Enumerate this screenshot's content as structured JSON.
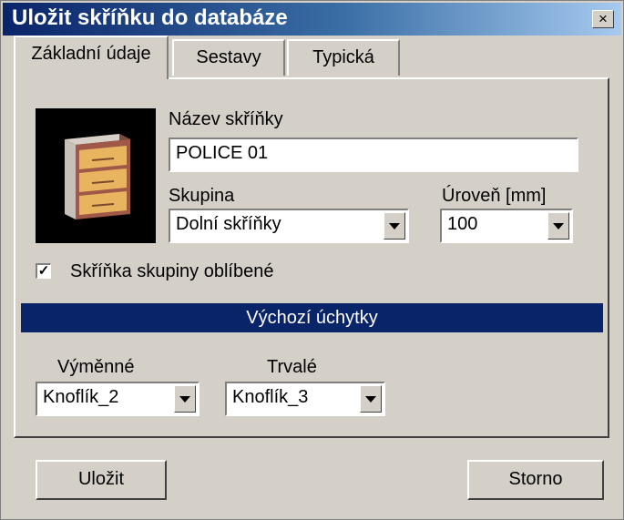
{
  "window": {
    "title": "Uložit skříňku do databáze",
    "close_label": "×"
  },
  "tabs": [
    {
      "label": "Základní údaje",
      "active": true
    },
    {
      "label": "Sestavy",
      "active": false
    },
    {
      "label": "Typická",
      "active": false
    }
  ],
  "form": {
    "name_label": "Název skříňky",
    "name_value": "POLICE 01",
    "group_label": "Skupina",
    "group_value": "Dolní skříňky",
    "level_label": "Úroveň [mm]",
    "level_value": "100",
    "favorite_label": "Skříňka skupiny oblíbené",
    "favorite_checked": true,
    "favorite_mark": "✓"
  },
  "handles": {
    "header": "Výchozí úchytky",
    "replaceable_label": "Výměnné",
    "replaceable_value": "Knoflík_2",
    "permanent_label": "Trvalé",
    "permanent_value": "Knoflík_3"
  },
  "buttons": {
    "save": "Uložit",
    "cancel": "Storno"
  },
  "icons": {
    "thumbnail": "cabinet-drawers-icon",
    "close": "close-icon",
    "dropdown": "chevron-down-icon"
  },
  "colors": {
    "title_bar": "#0a246a",
    "section_header": "#0a246a",
    "face": "#d4d0c8",
    "cabinet_front": "#e8b460"
  }
}
